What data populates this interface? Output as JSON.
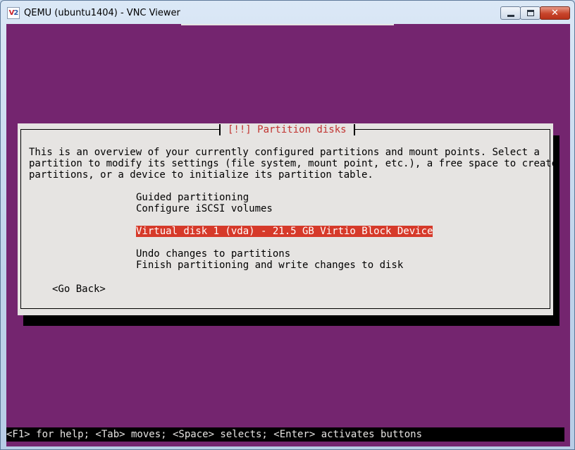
{
  "window": {
    "title": "QEMU (ubuntu1404) - VNC Viewer",
    "icon": "vnc-viewer-icon",
    "controls": [
      "minimize",
      "maximize",
      "close"
    ]
  },
  "dialog": {
    "title": "[!!] Partition disks",
    "description": [
      "This is an overview of your currently configured partitions and mount points. Select a",
      "partition to modify its settings (file system, mount point, etc.), a free space to create",
      "partitions, or a device to initialize its partition table."
    ],
    "options": [
      "Guided partitioning",
      "Configure iSCSI volumes",
      "Virtual disk 1 (vda) - 21.5 GB Virtio Block Device",
      "Undo changes to partitions",
      "Finish partitioning and write changes to disk"
    ],
    "selected_option": "Virtual disk 1 (vda) - 21.5 GB Virtio Block Device",
    "go_back": "<Go Back>"
  },
  "status_bar": "<F1> for help; <Tab> moves; <Space> selects; <Enter> activates buttons",
  "colors": {
    "background": "#74256f",
    "dialog": "#e6e4e2",
    "selection": "#d63a2a",
    "title_text": "#c13330"
  }
}
